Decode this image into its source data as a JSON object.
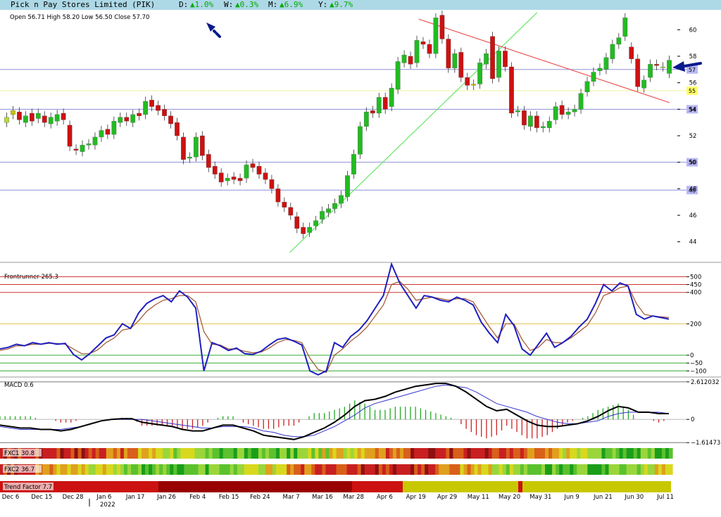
{
  "header": {
    "title": "Pick n Pay Stores Limited (PIK)",
    "day_label": "D:",
    "day_value": "▲1.0%",
    "week_label": "W:",
    "week_value": "▲0.3%",
    "month_label": "M:",
    "month_value": "▲6.9%",
    "year_label": "Y:",
    "year_value": "▲9.7%",
    "change_color": "#00aa00"
  },
  "chart_data": [
    {
      "type": "candlestick",
      "ohlc_label": "Open 56.71  High 58.20  Low 56.50  Close 57.70",
      "ylim": [
        42.5,
        61.5
      ],
      "yticks": [
        44,
        46,
        48,
        50,
        52,
        54,
        56,
        58,
        60
      ],
      "support_levels": [
        {
          "label": "57",
          "value": 57.0
        },
        {
          "label": "55",
          "value": 55.4
        },
        {
          "label": "54",
          "value": 54.0
        },
        {
          "label": "50",
          "value": 50.0
        },
        {
          "label": "48",
          "value": 47.9
        }
      ],
      "uptrend_line": {
        "from": [
          "Mar 7",
          43.2
        ],
        "to": [
          "May 31",
          61.3
        ]
      },
      "downtrend_line": {
        "from": [
          "Apr 19",
          60.8
        ],
        "to": [
          "Jul 11",
          54.5
        ]
      },
      "x_labels": [
        "Dec 6",
        "Dec 15",
        "Dec 28",
        "Jan 6",
        "Jan 17",
        "Jan 26",
        "Feb 4",
        "Feb 15",
        "Feb 24",
        "Mar 7",
        "Mar 16",
        "Mar 28",
        "Apr 6",
        "Apr 19",
        "Apr 29",
        "May 11",
        "May 20",
        "May 31",
        "Jun 9",
        "Jun 21",
        "Jun 30",
        "Jul 11"
      ],
      "year_label": "2022",
      "close_series": [
        53.4,
        53.6,
        53.2,
        53.5,
        53.1,
        53.7,
        53.0,
        53.4,
        53.6,
        53.2,
        51.2,
        50.9,
        51.3,
        51.4,
        51.9,
        52.4,
        52.1,
        53.1,
        53.4,
        53.1,
        53.6,
        53.5,
        54.6,
        54.2,
        53.9,
        53.5,
        52.9,
        52.0,
        50.2,
        50.4,
        51.9,
        50.5,
        49.6,
        49.1,
        48.5,
        48.8,
        48.7,
        48.6,
        49.8,
        49.6,
        49.1,
        48.7,
        48.0,
        47.0,
        46.6,
        46.0,
        45.0,
        44.6,
        45.1,
        45.6,
        46.3,
        46.5,
        46.9,
        47.5,
        49.0,
        50.6,
        52.7,
        53.8,
        53.7,
        54.9,
        54.0,
        55.6,
        57.6,
        58.1,
        57.4,
        59.2,
        58.9,
        58.2,
        60.9,
        59.3,
        57.1,
        58.2,
        56.4,
        55.8,
        55.8,
        57.5,
        58.2,
        56.3,
        58.4,
        57.2,
        53.7,
        53.9,
        52.8,
        53.5,
        52.6,
        52.7,
        53.1,
        54.2,
        53.6,
        53.8,
        54.0,
        55.2,
        56.1,
        56.8,
        57.1,
        57.9,
        58.9,
        59.4,
        60.9,
        57.8,
        55.7,
        56.2,
        57.4,
        57.3,
        57.2,
        57.7
      ],
      "open_series": [
        53.0,
        53.9,
        53.8,
        53.0,
        53.7,
        53.3,
        53.5,
        52.9,
        53.1,
        53.7,
        52.8,
        51.0,
        50.8,
        51.3,
        51.3,
        51.9,
        52.5,
        52.1,
        53.0,
        53.4,
        53.0,
        53.7,
        53.6,
        54.7,
        54.3,
        54.0,
        53.5,
        53.0,
        51.9,
        50.3,
        50.4,
        52.0,
        50.6,
        49.7,
        49.2,
        48.6,
        48.9,
        48.8,
        48.8,
        49.9,
        49.7,
        49.2,
        48.7,
        48.0,
        47.0,
        46.6,
        45.9,
        45.1,
        44.7,
        45.2,
        45.7,
        46.2,
        46.5,
        46.9,
        47.4,
        49.1,
        50.6,
        52.7,
        53.9,
        53.7,
        54.9,
        54.2,
        55.5,
        57.5,
        58.0,
        57.5,
        59.1,
        58.9,
        58.2,
        61.1,
        59.3,
        57.1,
        58.3,
        56.4,
        55.9,
        55.9,
        57.4,
        59.5,
        56.4,
        58.4,
        57.2,
        53.8,
        53.9,
        52.7,
        53.5,
        52.6,
        52.6,
        53.2,
        54.3,
        53.6,
        53.8,
        54.0,
        55.3,
        56.1,
        56.9,
        57.0,
        57.8,
        58.9,
        59.5,
        58.7,
        57.8,
        55.6,
        56.4,
        57.4,
        57.2,
        56.7
      ]
    },
    {
      "type": "line",
      "title": "Frontrunner 265.3",
      "ylim": [
        -130,
        560
      ],
      "level_lines": [
        500,
        450,
        400,
        200,
        0,
        -50,
        -100
      ],
      "tick_labels": [
        {
          "label": "500",
          "value": 500
        },
        {
          "label": "450",
          "value": 450
        },
        {
          "label": "400",
          "value": 400
        },
        {
          "label": "200",
          "value": 200
        },
        {
          "label": "0",
          "value": 0
        },
        {
          "label": "−50",
          "value": -50
        },
        {
          "label": "−100",
          "value": -100
        }
      ],
      "series": [
        {
          "color": "#1f1fbf",
          "values": [
            40,
            50,
            70,
            60,
            80,
            70,
            80,
            70,
            75,
            5,
            -30,
            10,
            60,
            110,
            130,
            200,
            170,
            270,
            330,
            360,
            380,
            340,
            410,
            370,
            300,
            -100,
            80,
            60,
            30,
            45,
            10,
            5,
            25,
            65,
            100,
            110,
            90,
            65,
            -100,
            -125,
            -100,
            80,
            50,
            120,
            160,
            220,
            300,
            380,
            580,
            460,
            380,
            300,
            380,
            370,
            350,
            340,
            370,
            350,
            320,
            210,
            140,
            80,
            260,
            190,
            40,
            0,
            70,
            140,
            50,
            80,
            120,
            180,
            230,
            330,
            450,
            410,
            460,
            440,
            260,
            230,
            250,
            240,
            230
          ]
        },
        {
          "color": "#a0522d",
          "values": [
            30,
            40,
            60,
            60,
            70,
            70,
            75,
            75,
            70,
            40,
            10,
            10,
            35,
            80,
            110,
            160,
            170,
            220,
            280,
            320,
            350,
            360,
            380,
            380,
            340,
            150,
            70,
            65,
            40,
            40,
            25,
            15,
            20,
            45,
            80,
            100,
            95,
            80,
            -20,
            -90,
            -110,
            0,
            40,
            90,
            130,
            180,
            250,
            320,
            450,
            470,
            420,
            350,
            360,
            370,
            360,
            350,
            360,
            360,
            340,
            260,
            180,
            110,
            200,
            200,
            100,
            30,
            50,
            100,
            80,
            80,
            110,
            150,
            190,
            270,
            380,
            400,
            430,
            440,
            330,
            260,
            250,
            245,
            240
          ]
        }
      ]
    },
    {
      "type": "line",
      "title": "MACD 0.6",
      "ylim": [
        -1.75,
        2.75
      ],
      "tick_labels": [
        {
          "label": "2.612032",
          "value": 2.612032
        },
        {
          "label": "0",
          "value": 0
        },
        {
          "label": "−1.614731",
          "value": -1.614731
        }
      ],
      "series": [
        {
          "color": "#000000",
          "values": [
            -0.4,
            -0.5,
            -0.6,
            -0.6,
            -0.7,
            -0.7,
            -0.8,
            -0.7,
            -0.5,
            -0.3,
            -0.1,
            0,
            0.05,
            0.05,
            -0.2,
            -0.3,
            -0.4,
            -0.5,
            -0.7,
            -0.8,
            -0.8,
            -0.6,
            -0.4,
            -0.4,
            -0.6,
            -0.8,
            -1.1,
            -1.2,
            -1.3,
            -1.4,
            -1.2,
            -0.9,
            -0.6,
            -0.2,
            0.3,
            0.9,
            1.3,
            1.4,
            1.6,
            1.9,
            2.1,
            2.3,
            2.4,
            2.5,
            2.5,
            2.3,
            1.9,
            1.4,
            0.9,
            0.6,
            0.7,
            0.3,
            -0.1,
            -0.4,
            -0.5,
            -0.5,
            -0.4,
            -0.3,
            -0.1,
            0.2,
            0.6,
            0.9,
            0.8,
            0.5,
            0.5,
            0.4,
            0.4
          ]
        },
        {
          "color": "#3333cc",
          "values": [
            -0.5,
            -0.6,
            -0.7,
            -0.7,
            -0.7,
            -0.7,
            -0.7,
            -0.6,
            -0.5,
            -0.3,
            -0.1,
            0,
            0,
            0,
            0,
            -0.1,
            -0.2,
            -0.3,
            -0.4,
            -0.5,
            -0.6,
            -0.6,
            -0.5,
            -0.5,
            -0.5,
            -0.6,
            -0.8,
            -0.9,
            -1.1,
            -1.2,
            -1.2,
            -1.1,
            -0.8,
            -0.5,
            -0.1,
            0.3,
            0.8,
            1.1,
            1.3,
            1.5,
            1.7,
            1.9,
            2.1,
            2.3,
            2.4,
            2.3,
            2.2,
            1.9,
            1.5,
            1.1,
            0.9,
            0.7,
            0.5,
            0.2,
            0,
            -0.2,
            -0.3,
            -0.3,
            -0.2,
            -0.1,
            0.2,
            0.4,
            0.5,
            0.5,
            0.5,
            0.5,
            0.4
          ]
        }
      ]
    }
  ],
  "fxc1_label": "FXC1 30.8",
  "fxc2_label": "FXC2 36.7",
  "trend_factor_label": "Trend Factor 7.7"
}
